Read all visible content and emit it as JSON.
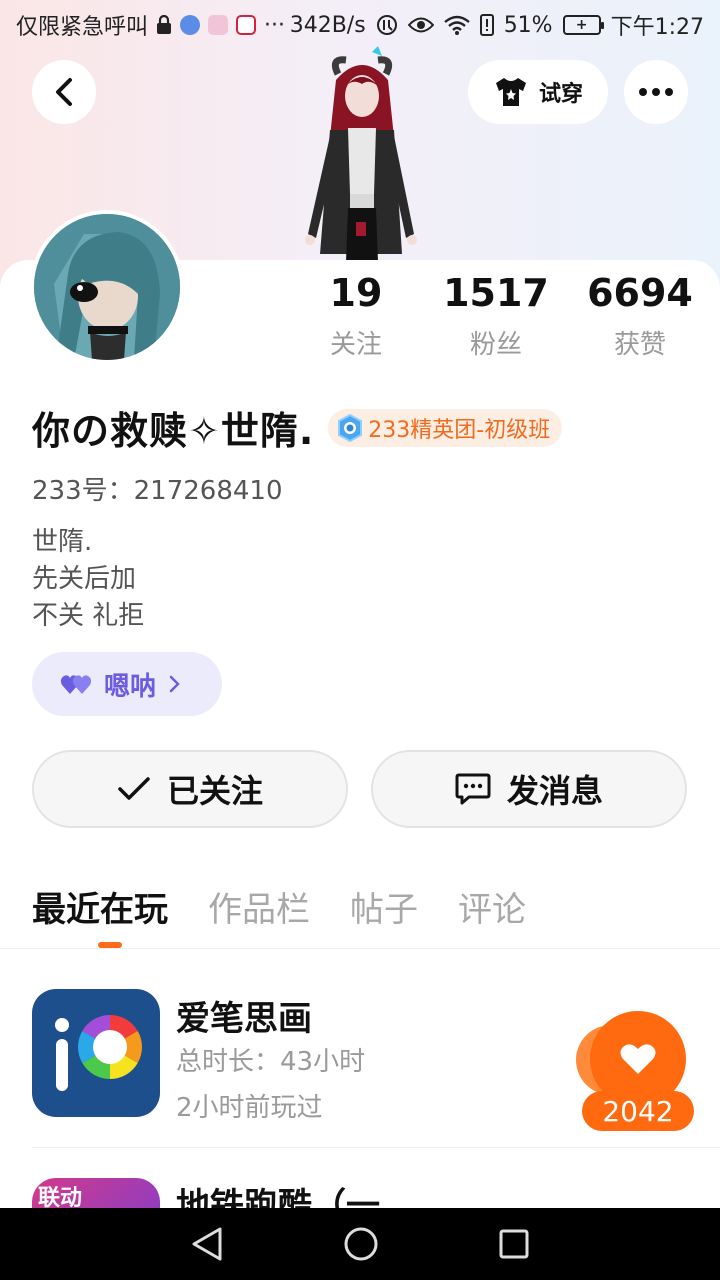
{
  "status_bar": {
    "carrier": "仅限紧急呼叫",
    "speed": "342B/s",
    "battery": "51%",
    "time": "下午1:27"
  },
  "header": {
    "tryon_label": "试穿"
  },
  "profile": {
    "username": "你の救赎✧世隋.",
    "badge": "233精英团-初级班",
    "id_line": "233号：217268410",
    "bio": [
      "世隋.",
      "先关后加",
      "不关 礼拒"
    ],
    "tag_label": "嗯呐"
  },
  "stats": [
    {
      "value": "19",
      "label": "关注"
    },
    {
      "value": "1517",
      "label": "粉丝"
    },
    {
      "value": "6694",
      "label": "获赞"
    }
  ],
  "actions": {
    "follow_label": "已关注",
    "message_label": "发消息"
  },
  "tabs": [
    {
      "label": "最近在玩",
      "active": true
    },
    {
      "label": "作品栏",
      "active": false
    },
    {
      "label": "帖子",
      "active": false
    },
    {
      "label": "评论",
      "active": false
    }
  ],
  "games": [
    {
      "title": "爱笔思画",
      "duration": "总时长：43小时",
      "last_played": "2小时前玩过",
      "likes": "2042"
    },
    {
      "title": "地铁跑酷（一…",
      "icon_text": "联动"
    }
  ],
  "colors": {
    "accent": "#ff6a10",
    "tag_purple": "#6a5de0",
    "badge_orange": "#f26b1d"
  }
}
